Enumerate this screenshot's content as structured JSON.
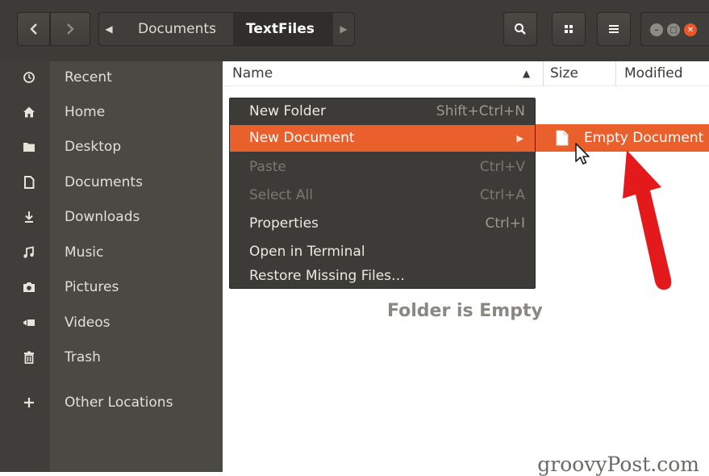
{
  "header": {
    "path": {
      "parent": "Documents",
      "current": "TextFiles"
    },
    "icons": {
      "back": "chevron-left-icon",
      "forward": "chevron-right-icon",
      "path_left": "caret-left-icon",
      "path_right": "caret-right-icon",
      "search": "search-icon",
      "view": "grid-view-icon",
      "menu": "hamburger-menu-icon"
    }
  },
  "sidebar": {
    "items": [
      {
        "label": "Recent",
        "icon": "clock-icon"
      },
      {
        "label": "Home",
        "icon": "home-icon"
      },
      {
        "label": "Desktop",
        "icon": "folder-icon"
      },
      {
        "label": "Documents",
        "icon": "document-icon"
      },
      {
        "label": "Downloads",
        "icon": "download-icon"
      },
      {
        "label": "Music",
        "icon": "music-icon"
      },
      {
        "label": "Pictures",
        "icon": "camera-icon"
      },
      {
        "label": "Videos",
        "icon": "video-icon"
      },
      {
        "label": "Trash",
        "icon": "trash-icon"
      },
      {
        "label": "Other Locations",
        "icon": "plus-icon"
      }
    ]
  },
  "columns": {
    "name": "Name",
    "size": "Size",
    "modified": "Modified"
  },
  "empty_message": "Folder is Empty",
  "context_menu": {
    "items": [
      {
        "label": "New Folder",
        "accel": "Shift+Ctrl+N",
        "state": "normal"
      },
      {
        "label": "New Document",
        "accel": "",
        "state": "active"
      },
      {
        "label": "Paste",
        "accel": "Ctrl+V",
        "state": "disabled"
      },
      {
        "label": "Select All",
        "accel": "Ctrl+A",
        "state": "disabled"
      },
      {
        "label": "Properties",
        "accel": "Ctrl+I",
        "state": "normal"
      },
      {
        "label": "Open in Terminal",
        "accel": "",
        "state": "normal"
      },
      {
        "label": "Restore Missing Files…",
        "accel": "",
        "state": "normal"
      }
    ]
  },
  "submenu": {
    "label": "Empty Document",
    "icon": "blank-document-icon"
  },
  "watermark": "groovyPost.com",
  "colors": {
    "accent": "#e9602c",
    "annotation_arrow": "#e3191c",
    "headerbar": "#3c3b37",
    "sidebar": "#4a4944"
  }
}
